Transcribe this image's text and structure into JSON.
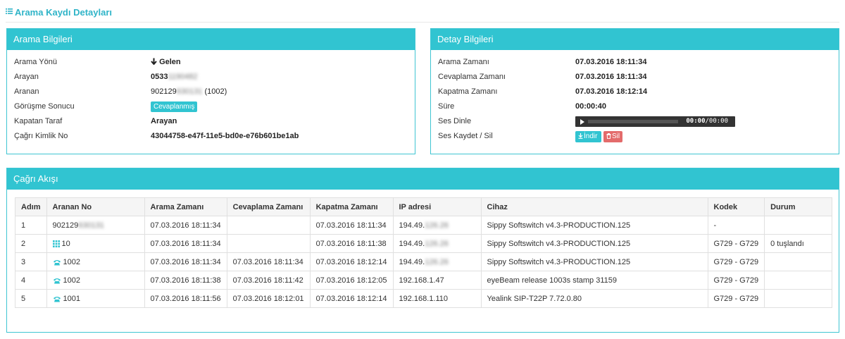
{
  "page": {
    "title": "Arama Kaydı Detayları",
    "icon": "list-icon"
  },
  "arama_bilgileri": {
    "heading": "Arama Bilgileri",
    "rows": [
      {
        "label": "Arama Yönü",
        "value": "Gelen",
        "icon": "arrow-down-icon"
      },
      {
        "label": "Arayan",
        "value_visible": "0533",
        "value_blurred": "1190482"
      },
      {
        "label": "Aranan",
        "value_visible": "902129",
        "value_blurred": "630131",
        "value_suffix": " (1002)"
      },
      {
        "label": "Görüşme Sonucu",
        "badge": "Cevaplanmış"
      },
      {
        "label": "Kapatan Taraf",
        "value": "Arayan"
      },
      {
        "label": "Çağrı Kimlik No",
        "value": "43044758-e47f-11e5-bd0e-e76b601be1ab"
      }
    ]
  },
  "detay_bilgileri": {
    "heading": "Detay Bilgileri",
    "rows": [
      {
        "label": "Arama Zamanı",
        "value": "07.03.2016 18:11:34"
      },
      {
        "label": "Cevaplama Zamanı",
        "value": "07.03.2016 18:11:34"
      },
      {
        "label": "Kapatma Zamanı",
        "value": "07.03.2016 18:12:14"
      },
      {
        "label": "Süre",
        "value": "00:00:40"
      },
      {
        "label": "Ses Dinle"
      },
      {
        "label": "Ses Kaydet / Sil"
      }
    ],
    "player": {
      "current_time": "00:00",
      "separator": "/",
      "duration": "00:00",
      "progress": 0
    },
    "download_button": "İndir",
    "delete_button": "Sil"
  },
  "cagri_akisi": {
    "heading": "Çağrı Akışı",
    "columns": [
      "Adım",
      "Aranan No",
      "Arama Zamanı",
      "Cevaplama Zamanı",
      "Kapatma Zamanı",
      "IP adresi",
      "Cihaz",
      "Kodek",
      "Durum"
    ],
    "rows": [
      {
        "adim": "1",
        "icon": "",
        "no_visible": "902129",
        "no_blurred": "630131",
        "arama": "07.03.2016 18:11:34",
        "cevaplama": "",
        "kapatma": "07.03.2016 18:11:34",
        "ip_visible": "194.49.",
        "ip_blurred": "126.26",
        "cihaz": "Sippy Softswitch v4.3-PRODUCTION.125",
        "kodek": "-",
        "durum": ""
      },
      {
        "adim": "2",
        "icon": "keypad-icon",
        "no_visible": "10",
        "no_blurred": "",
        "arama": "07.03.2016 18:11:34",
        "cevaplama": "",
        "kapatma": "07.03.2016 18:11:38",
        "ip_visible": "194.49.",
        "ip_blurred": "126.26",
        "cihaz": "Sippy Softswitch v4.3-PRODUCTION.125",
        "kodek": "G729 - G729",
        "durum": "0 tuşlandı"
      },
      {
        "adim": "3",
        "icon": "phone-icon",
        "no_visible": "1002",
        "no_blurred": "",
        "arama": "07.03.2016 18:11:34",
        "cevaplama": "07.03.2016 18:11:34",
        "kapatma": "07.03.2016 18:12:14",
        "ip_visible": "194.49.",
        "ip_blurred": "126.26",
        "cihaz": "Sippy Softswitch v4.3-PRODUCTION.125",
        "kodek": "G729 - G729",
        "durum": ""
      },
      {
        "adim": "4",
        "icon": "phone-icon",
        "no_visible": "1002",
        "no_blurred": "",
        "arama": "07.03.2016 18:11:38",
        "cevaplama": "07.03.2016 18:11:42",
        "kapatma": "07.03.2016 18:12:05",
        "ip_visible": "192.168.1.47",
        "ip_blurred": "",
        "cihaz": "eyeBeam release 1003s stamp 31159",
        "kodek": "G729 - G729",
        "durum": ""
      },
      {
        "adim": "5",
        "icon": "phone-icon",
        "no_visible": "1001",
        "no_blurred": "",
        "arama": "07.03.2016 18:11:56",
        "cevaplama": "07.03.2016 18:12:01",
        "kapatma": "07.03.2016 18:12:14",
        "ip_visible": "192.168.1.110",
        "ip_blurred": "",
        "cihaz": "Yealink SIP-T22P 7.72.0.80",
        "kodek": "G729 - G729",
        "durum": ""
      }
    ]
  },
  "colors": {
    "accent": "#31c4d1",
    "title": "#2fb4c8",
    "danger": "#e36b6b",
    "player_bg": "#333333"
  }
}
